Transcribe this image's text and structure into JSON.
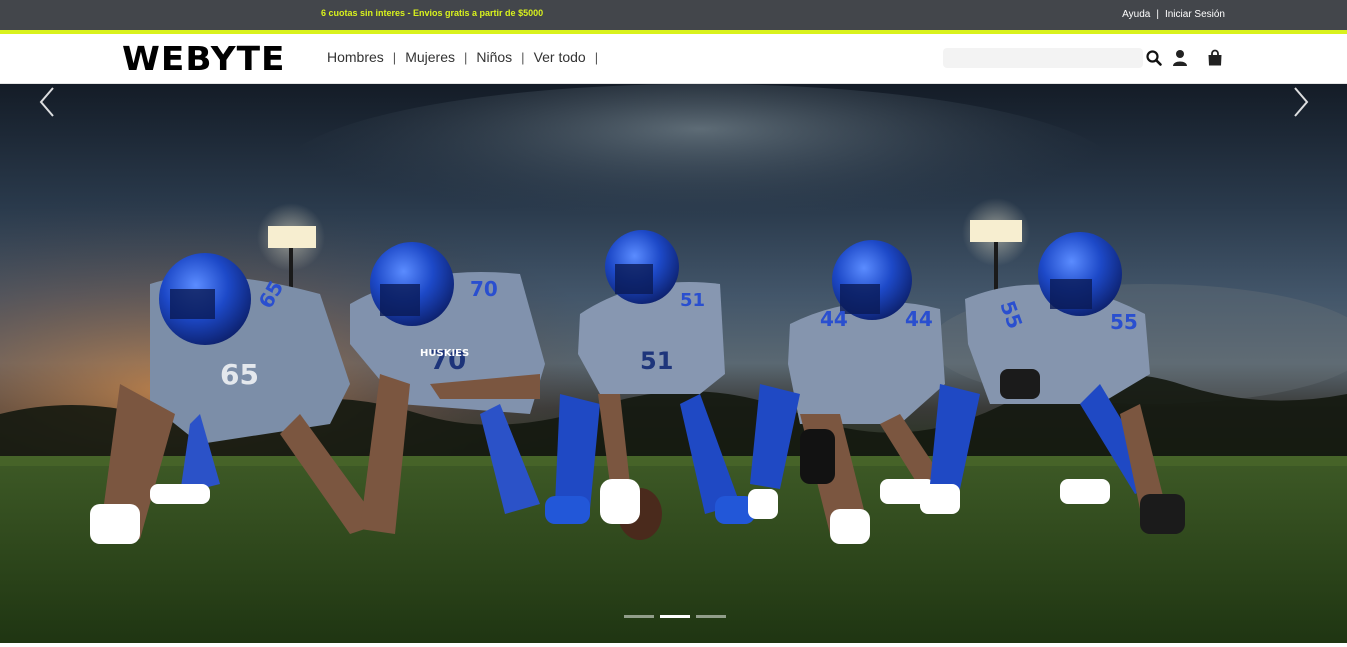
{
  "topbar": {
    "promo": "6 cuotas sin interes - Envios gratis a partir de $5000",
    "help": "Ayuda",
    "separator": "|",
    "login": "Iniciar Sesión"
  },
  "header": {
    "logo": "WEBYTE",
    "nav": [
      {
        "label": "Hombres"
      },
      {
        "label": "Mujeres"
      },
      {
        "label": "Niños"
      },
      {
        "label": "Ver todo"
      }
    ],
    "nav_separator": "|",
    "search": {
      "value": "",
      "placeholder": ""
    },
    "icons": [
      "search-icon",
      "user-icon",
      "shopping-bag-icon"
    ]
  },
  "hero": {
    "slides_count": 3,
    "active_slide": 2,
    "players": [
      {
        "number": "65",
        "team": "HUSKIES"
      },
      {
        "number": "70",
        "team": "HUSKIES"
      },
      {
        "number": "51",
        "team": "HUSKIES"
      },
      {
        "number": "44",
        "team": "HUSKIES"
      },
      {
        "number": "55",
        "team": "HUSKIES"
      }
    ]
  },
  "colors": {
    "topbar_bg": "#43464b",
    "accent": "#d9f21d",
    "jersey_blue": "#1f4fd6",
    "grass": "#2f4a1e"
  }
}
